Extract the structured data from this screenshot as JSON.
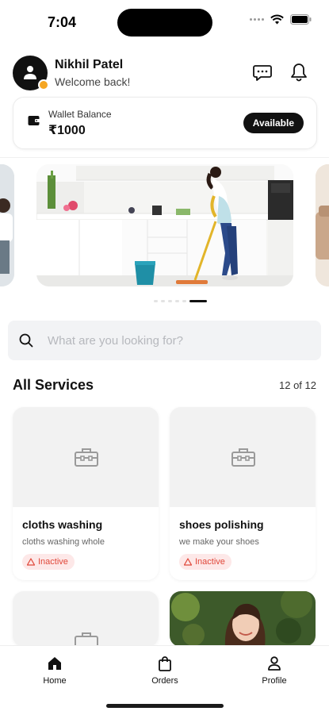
{
  "status": {
    "time": "7:04"
  },
  "user": {
    "name": "Nikhil Patel",
    "greeting": "Welcome back!"
  },
  "wallet": {
    "label": "Wallet Balance",
    "amount": "₹1000",
    "status_label": "Available"
  },
  "carousel": {
    "slides": 3,
    "active_index": 5,
    "indicator_count": 6
  },
  "search": {
    "placeholder": "What are you looking for?"
  },
  "services": {
    "title": "All Services",
    "count": "12 of 12",
    "items": [
      {
        "title": "cloths washing",
        "description": "cloths washing whole",
        "status": "Inactive"
      },
      {
        "title": "shoes polishing",
        "description": "we make your shoes",
        "status": "Inactive"
      }
    ]
  },
  "tabbar": {
    "home": "Home",
    "orders": "Orders",
    "profile": "Profile"
  },
  "colors": {
    "accent": "#111111",
    "badge_bg": "#fde8e8",
    "badge_text": "#e0483a",
    "online_dot": "#f5a623"
  }
}
